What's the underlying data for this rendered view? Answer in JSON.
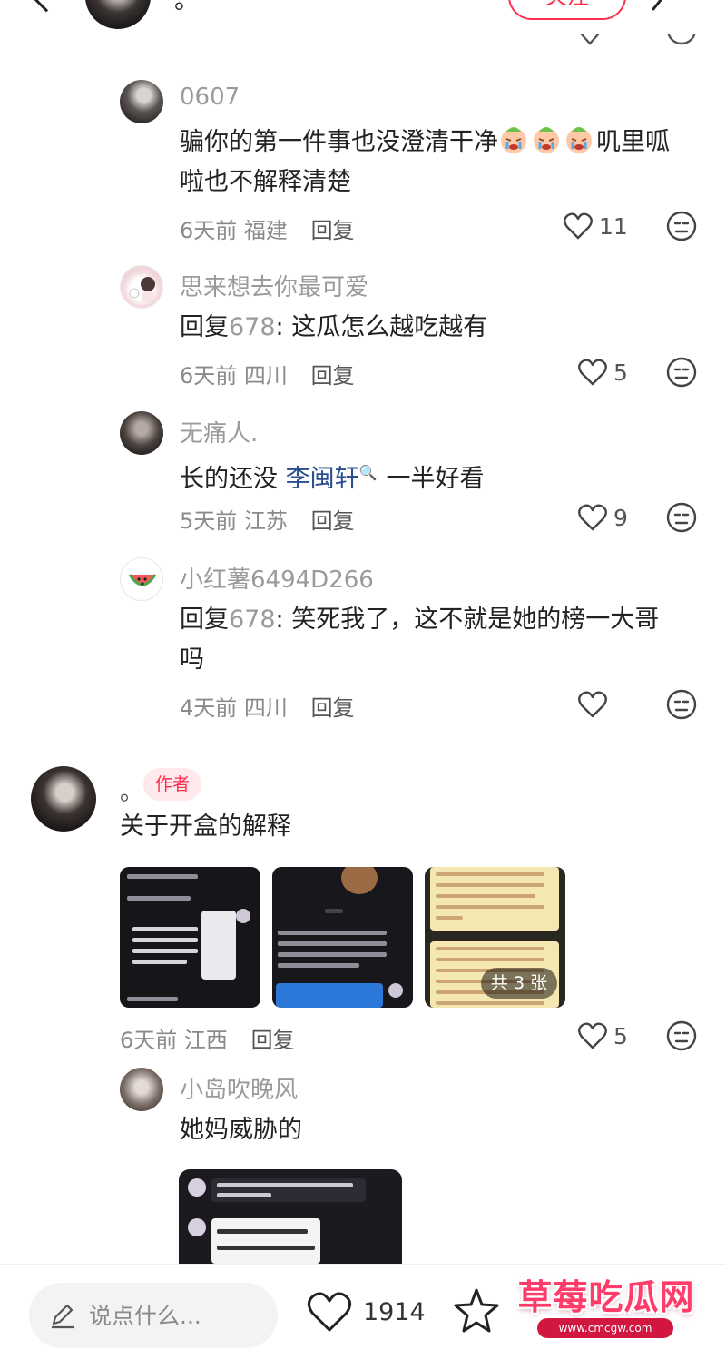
{
  "header": {
    "author_name": "。",
    "follow_label": "关注"
  },
  "comments": [
    {
      "username": "0607",
      "text_before_emoji": "骗你的第一件事也没澄清干净",
      "text_after_emoji": "叽里呱",
      "text_line2": "啦也不解释清楚",
      "time": "6天前",
      "location": "福建",
      "reply_label": "回复",
      "likes": "11"
    },
    {
      "username": "思来想去你最可爱",
      "reply_prefix": "回复",
      "reply_to": "678",
      "text": ": 这瓜怎么越吃越有",
      "time": "6天前",
      "location": "四川",
      "reply_label": "回复",
      "likes": "5"
    },
    {
      "username": "无痛人.",
      "text_before_link": "长的还没",
      "link_text": "李闽轩",
      "link_icon": "🔍",
      "text_after_link": "一半好看",
      "time": "5天前",
      "location": "江苏",
      "reply_label": "回复",
      "likes": "9"
    },
    {
      "username": "小红薯6494D266",
      "reply_prefix": "回复",
      "reply_to": "678",
      "text": ": 笑死我了，这不就是她的榜一大哥",
      "text_line2": "吗",
      "time": "4天前",
      "location": "四川",
      "reply_label": "回复",
      "likes": ""
    },
    {
      "username": "。",
      "author_badge": "作者",
      "text": "关于开盒的解释",
      "image_count": "共 3 张",
      "time": "6天前",
      "location": "江西",
      "reply_label": "回复",
      "likes": "5"
    },
    {
      "username": "小岛吹晚风",
      "text": "她妈威胁的"
    }
  ],
  "bottom_bar": {
    "input_placeholder": "说点什么...",
    "like_count": "1914"
  },
  "watermark": {
    "title": "草莓吃瓜网",
    "url": "www.cmcgw.com"
  },
  "colors": {
    "accent": "#ff2e4d",
    "link": "#2a4e8e",
    "muted": "#9a9a9a"
  }
}
